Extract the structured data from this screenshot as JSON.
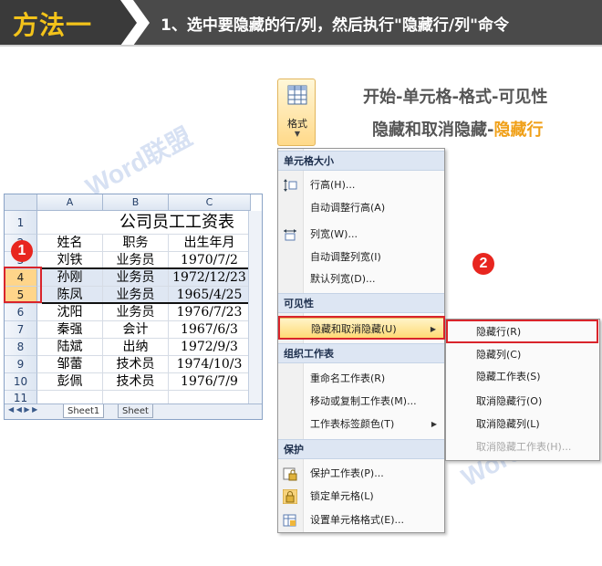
{
  "banner": {
    "method": "方法一",
    "instruction": "1、选中要隐藏的行/列，然后执行\"隐藏行/列\"命令"
  },
  "headlines": {
    "line1": "开始-单元格-格式-可见性",
    "line2_prefix": "隐藏和取消隐藏-",
    "line2_highlight": "隐藏行"
  },
  "ribbon": {
    "format_label": "格式",
    "caret": "▼"
  },
  "menu": {
    "sections": [
      {
        "header": "单元格大小",
        "items": [
          "行高(H)...",
          "自动调整行高(A)",
          "列宽(W)...",
          "自动调整列宽(I)",
          "默认列宽(D)..."
        ]
      },
      {
        "header": "可见性",
        "items": [
          "隐藏和取消隐藏(U)"
        ]
      },
      {
        "header": "组织工作表",
        "items": [
          "重命名工作表(R)",
          "移动或复制工作表(M)...",
          "工作表标签颜色(T)"
        ]
      },
      {
        "header": "保护",
        "items": [
          "保护工作表(P)...",
          "锁定单元格(L)",
          "设置单元格格式(E)..."
        ]
      }
    ],
    "submenu_arrow": "▶"
  },
  "submenu": {
    "items": [
      "隐藏行(R)",
      "隐藏列(C)",
      "隐藏工作表(S)",
      "取消隐藏行(O)",
      "取消隐藏列(L)",
      "取消隐藏工作表(H)..."
    ]
  },
  "badges": {
    "one": "1",
    "two": "2"
  },
  "sheet": {
    "columns": [
      "A",
      "B",
      "C"
    ],
    "title": "公司员工工资表",
    "rows": [
      {
        "num": "1",
        "cells": [
          "",
          "",
          ""
        ]
      },
      {
        "num": "2",
        "cells": [
          "姓名",
          "职务",
          "出生年月"
        ]
      },
      {
        "num": "3",
        "cells": [
          "刘铁",
          "业务员",
          "1970/7/2"
        ]
      },
      {
        "num": "4",
        "cells": [
          "孙刚",
          "业务员",
          "1972/12/23"
        ]
      },
      {
        "num": "5",
        "cells": [
          "陈凤",
          "业务员",
          "1965/4/25"
        ]
      },
      {
        "num": "6",
        "cells": [
          "沈阳",
          "业务员",
          "1976/7/23"
        ]
      },
      {
        "num": "7",
        "cells": [
          "秦强",
          "会计",
          "1967/6/3"
        ]
      },
      {
        "num": "8",
        "cells": [
          "陆斌",
          "出纳",
          "1972/9/3"
        ]
      },
      {
        "num": "9",
        "cells": [
          "邹蕾",
          "技术员",
          "1974/10/3"
        ]
      },
      {
        "num": "10",
        "cells": [
          "彭佩",
          "技术员",
          "1976/7/9"
        ]
      },
      {
        "num": "11",
        "cells": [
          "",
          "",
          ""
        ]
      }
    ],
    "tabs": [
      "Sheet1",
      "Sheet"
    ],
    "nav": "◀ ◀ ▶ ▶"
  },
  "watermark": "Word联盟",
  "colors": {
    "highlight": "#f0a018",
    "red": "#d9242b",
    "badge": "#e8261f"
  }
}
